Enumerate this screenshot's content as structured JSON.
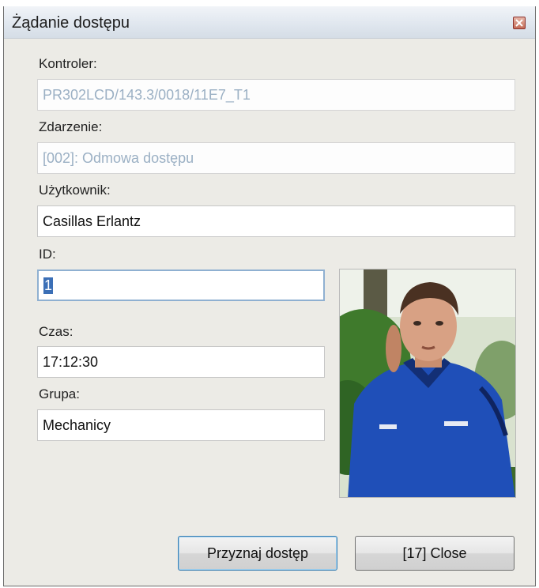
{
  "window": {
    "title": "Żądanie dostępu"
  },
  "fields": {
    "controller_label": "Kontroler:",
    "controller_value": "PR302LCD/143.3/0018/11E7_T1",
    "event_label": "Zdarzenie:",
    "event_value": "[002]: Odmowa dostępu",
    "user_label": "Użytkownik:",
    "user_value": "Casillas Erlantz",
    "id_label": "ID:",
    "id_value": "1",
    "time_label": "Czas:",
    "time_value": "17:12:30",
    "group_label": "Grupa:",
    "group_value": "Mechanicy"
  },
  "buttons": {
    "grant_label": "Przyznaj dostęp",
    "close_label": "[17] Close"
  },
  "colors": {
    "disabled_text": "#9bb0c4",
    "jacket_blue": "#1f4fb8",
    "selection": "#3b6fb6"
  },
  "icons": {
    "titlebar_close": "close-icon"
  }
}
